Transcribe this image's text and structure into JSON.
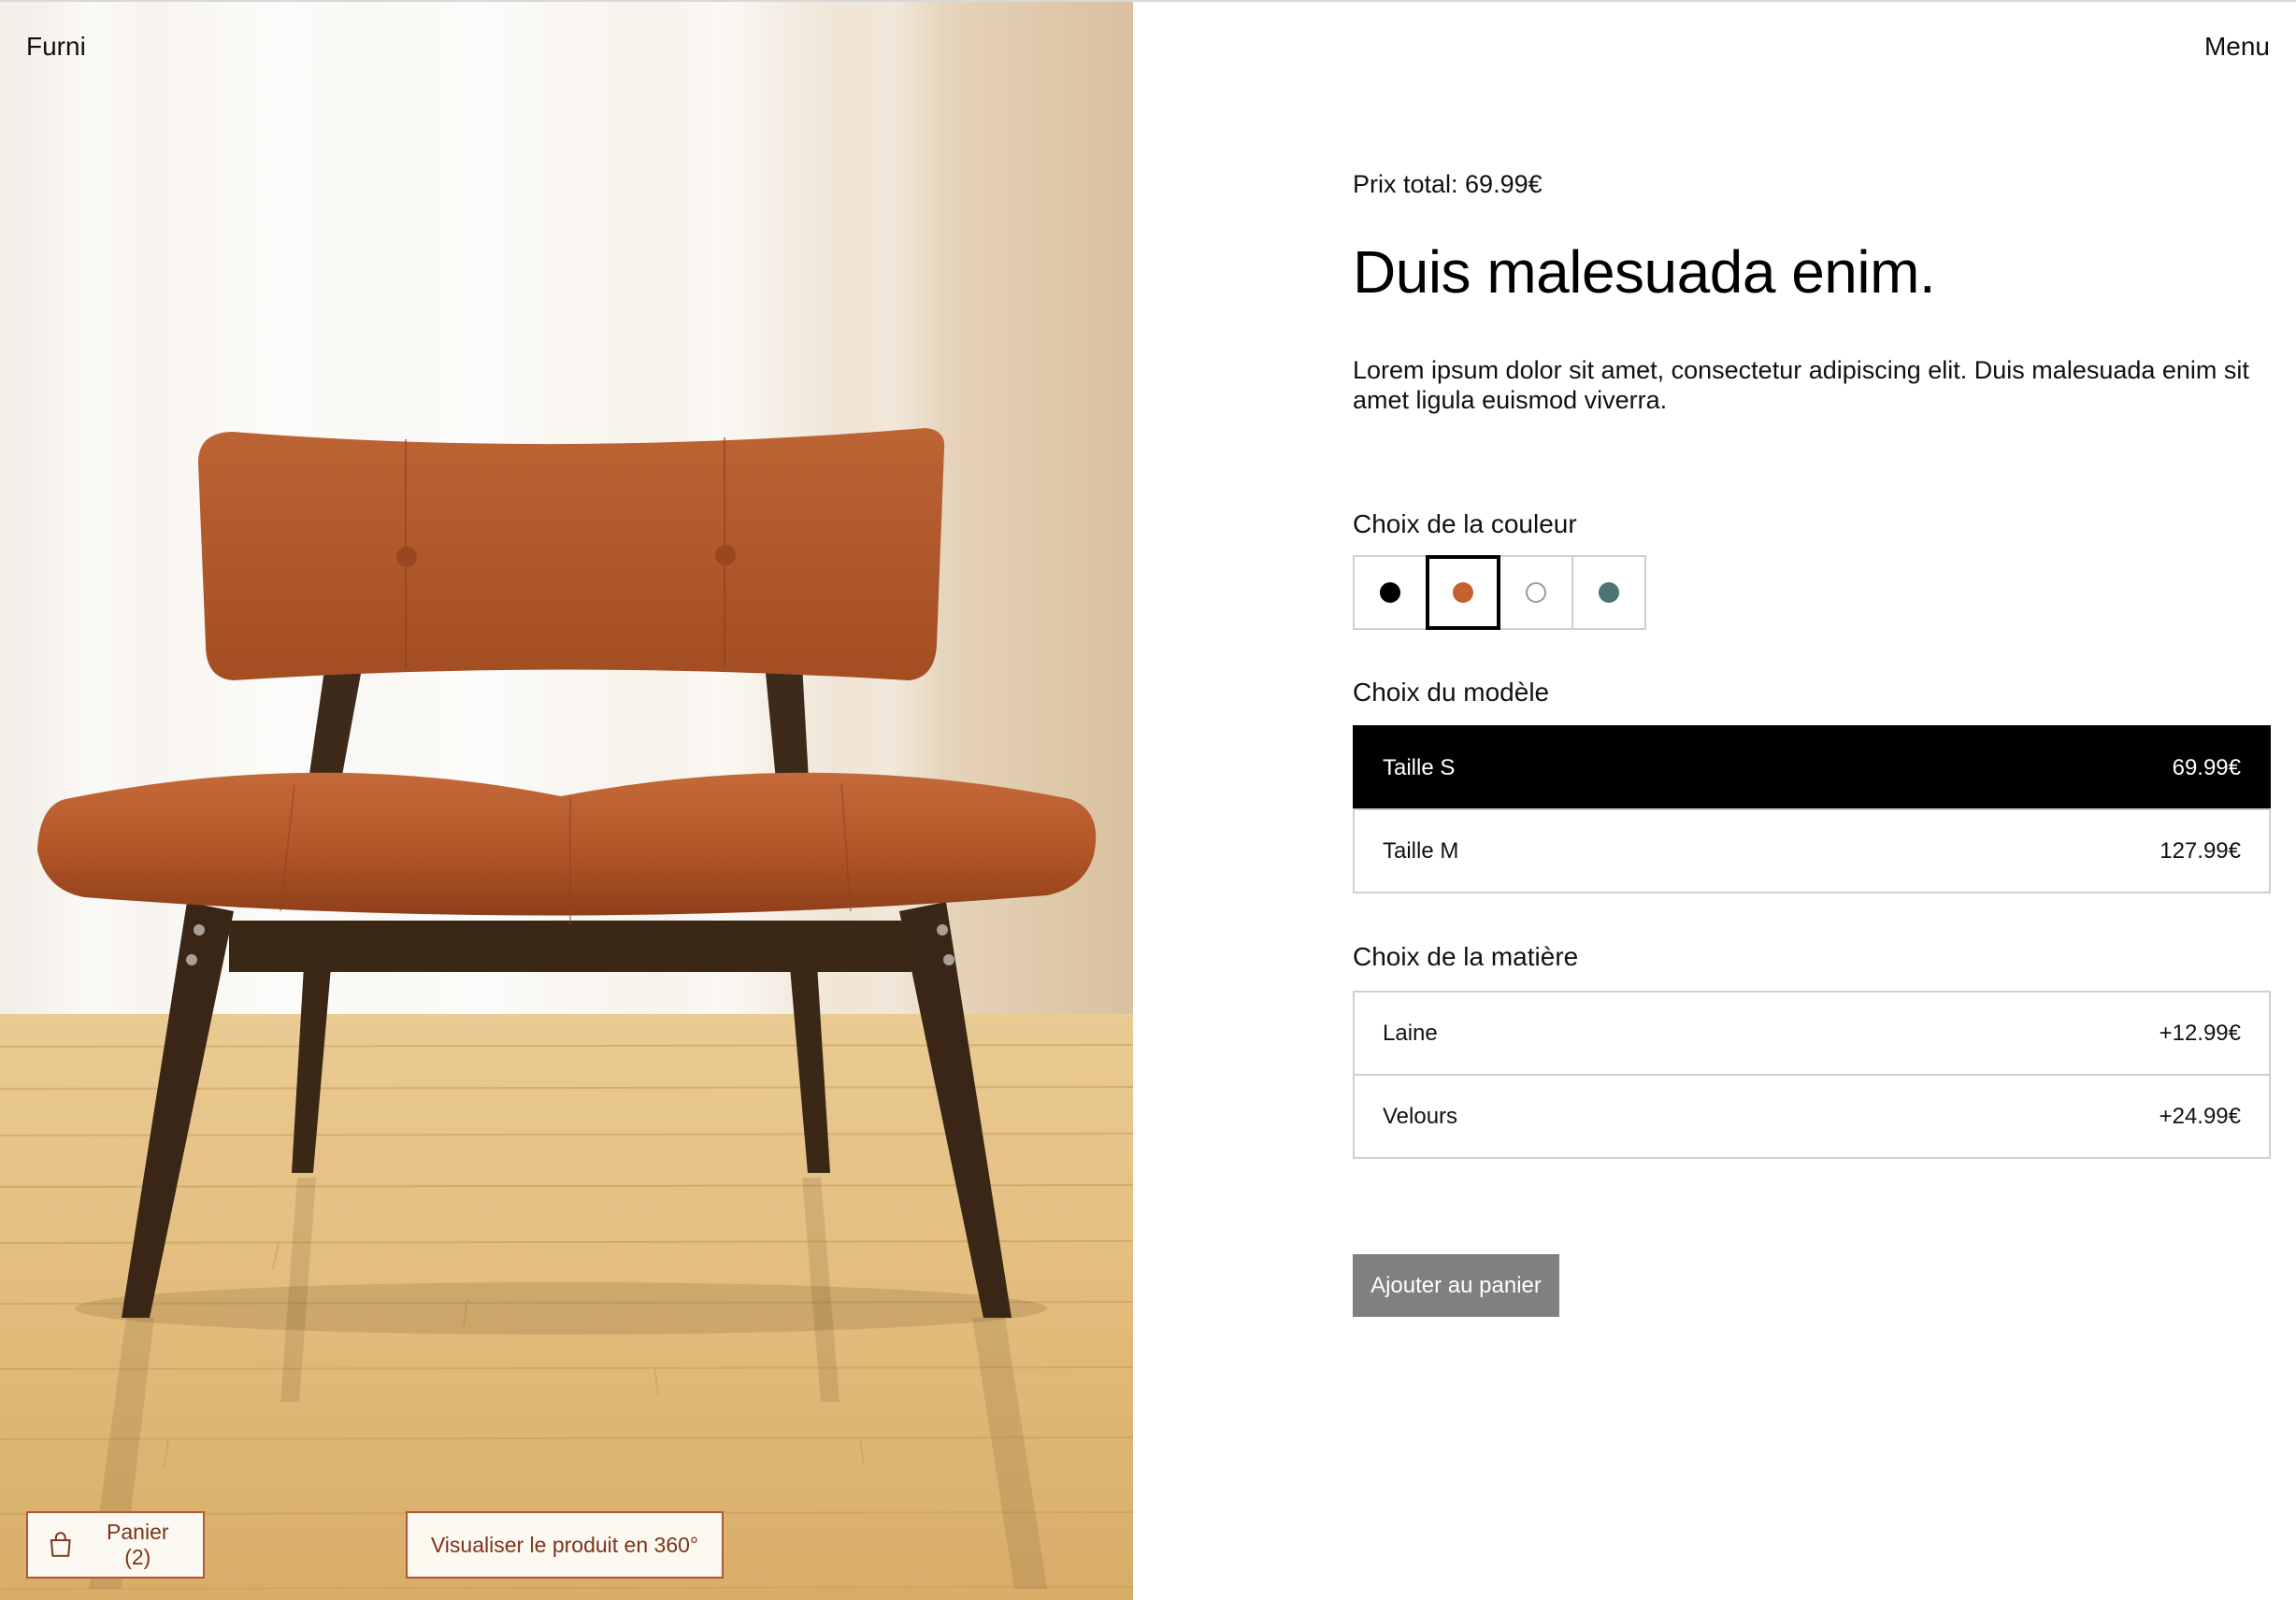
{
  "brand": "Furni",
  "menu_label": "Menu",
  "product": {
    "price_total": "Prix total: 69.99€",
    "title": "Duis malesuada enim.",
    "description": "Lorem ipsum dolor sit amet, consectetur adipiscing elit. Duis malesuada enim sit amet ligula euismod viverra."
  },
  "color_section": {
    "label": "Choix de la couleur",
    "swatches": [
      {
        "color": "#000000",
        "selected": false
      },
      {
        "color": "#c4612e",
        "selected": true
      },
      {
        "color": "#ffffff",
        "selected": false
      },
      {
        "color": "#4d7374",
        "selected": false
      }
    ]
  },
  "model_section": {
    "label": "Choix du modèle",
    "options": [
      {
        "name": "Taille S",
        "price": "69.99€",
        "selected": true
      },
      {
        "name": "Taille M",
        "price": "127.99€",
        "selected": false
      }
    ]
  },
  "material_section": {
    "label": "Choix de la matière",
    "options": [
      {
        "name": "Laine",
        "price": "+12.99€"
      },
      {
        "name": "Velours",
        "price": "+24.99€"
      }
    ]
  },
  "add_to_cart_label": "Ajouter au panier",
  "photo_buttons": {
    "cart_label": "Panier (2)",
    "view_360_label": "Visualiser le produit en 360°"
  },
  "colors": {
    "accent": "#b0593a",
    "chair": "#b4582b",
    "button_grey": "#808080"
  }
}
